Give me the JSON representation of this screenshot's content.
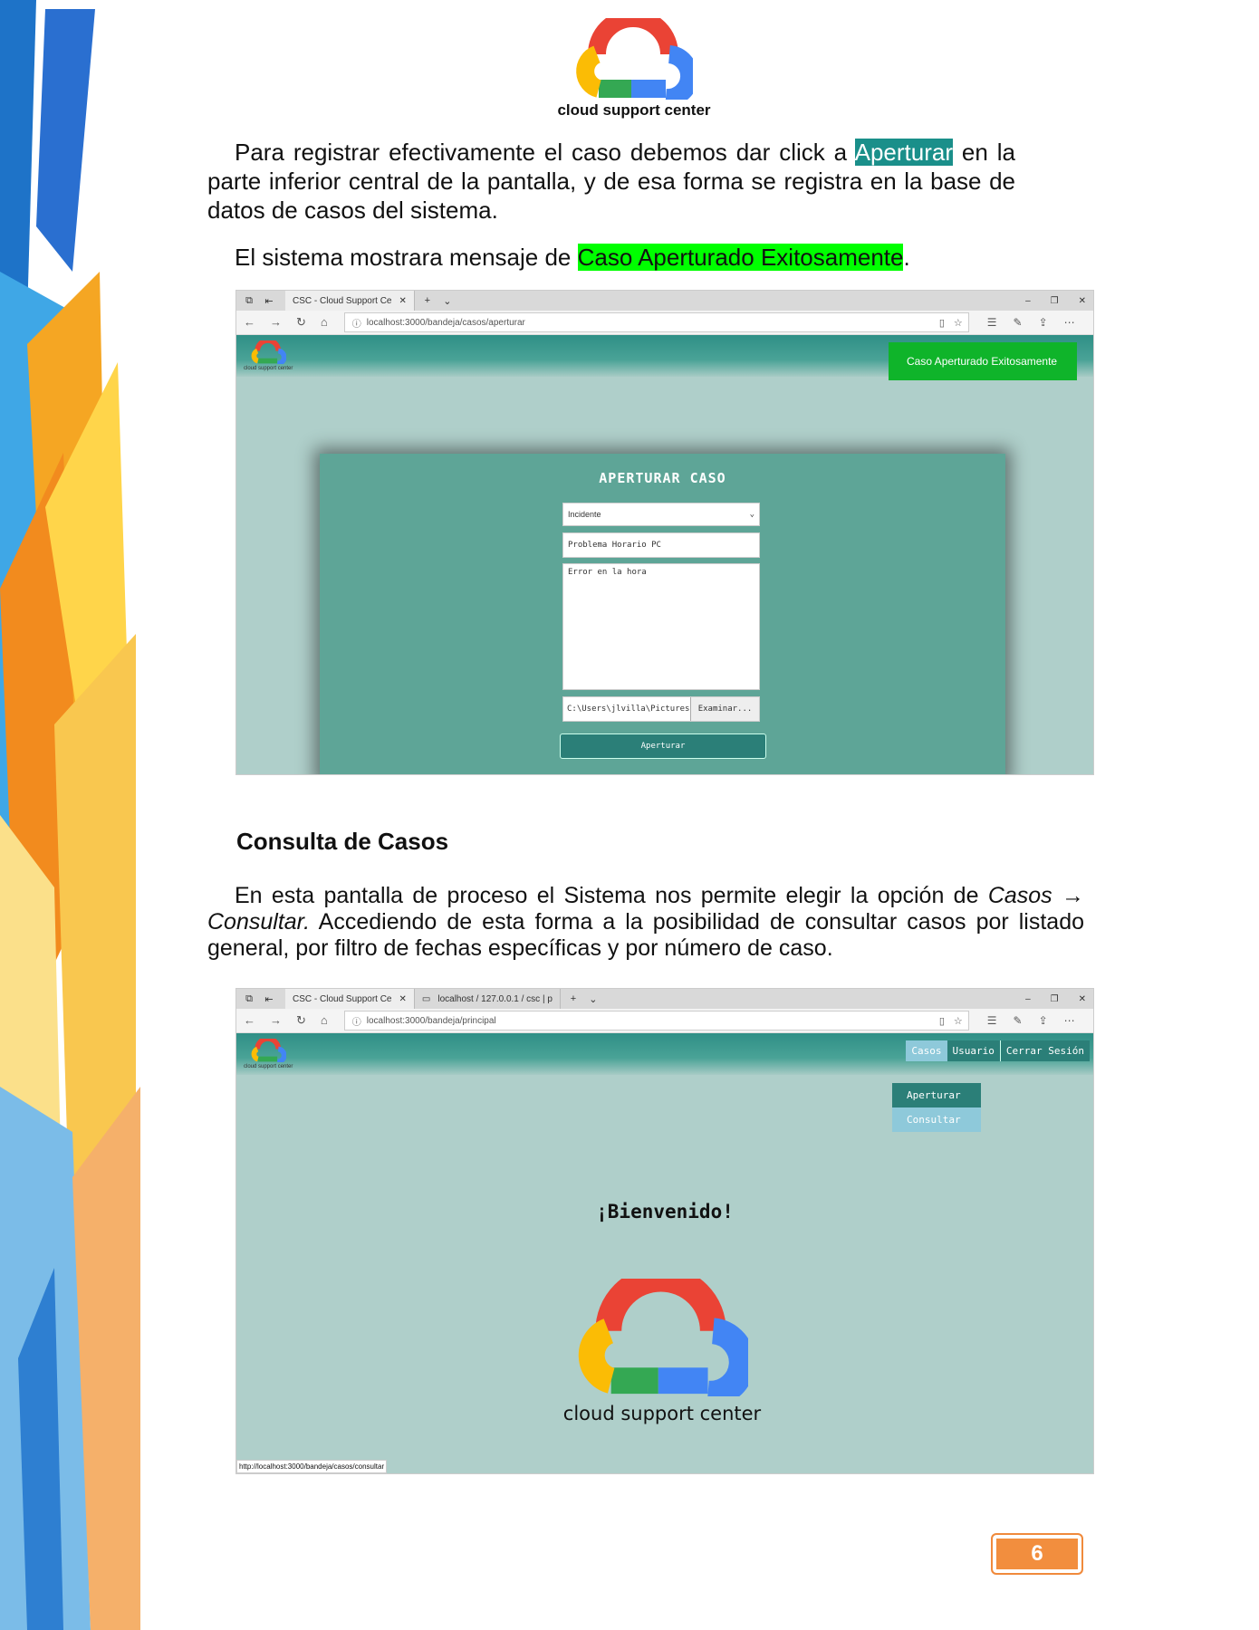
{
  "header": {
    "brand": "cloud support center"
  },
  "para1": {
    "before": "Para registrar efectivamente el caso debemos dar click a ",
    "highlight": "Aperturar",
    "after": " en la parte inferior central de la pantalla, y de esa forma se registra en la base de datos de casos del sistema."
  },
  "para2": {
    "before": "El sistema mostrara mensaje de ",
    "highlight": "Caso Aperturado Exitosamente",
    "after": "."
  },
  "shot1": {
    "tab_title": "CSC - Cloud Support Ce",
    "url": "localhost:3000/bandeja/casos/aperturar",
    "mini_brand": "cloud support center",
    "toast": "Caso Aperturado Exitosamente",
    "form": {
      "title": "APERTURAR CASO",
      "type_value": "Incidente",
      "subject_value": "Problema Horario PC",
      "description_value": "Error en la hora",
      "file_value": "C:\\Users\\jlvilla\\Pictures\\He",
      "browse_label": "Examinar...",
      "submit_label": "Aperturar"
    }
  },
  "section_title": "Consulta de Casos",
  "para3": {
    "before": "En esta pantalla de proceso el Sistema nos permite elegir la opción de ",
    "italic": "Casos → Consultar.",
    "after": " Accediendo de esta forma a la posibilidad de consultar casos por listado general, por filtro de fechas específicas y por número de caso."
  },
  "shot2": {
    "tab_title": "CSC - Cloud Support Ce",
    "tab2_title": "localhost / 127.0.0.1 / csc | p",
    "url": "localhost:3000/bandeja/principal",
    "mini_brand": "cloud support center",
    "menu": {
      "casos": "Casos",
      "usuario": "Usuario",
      "logout": "Cerrar Sesión"
    },
    "dropdown": {
      "aperturar": "Aperturar",
      "consultar": "Consultar"
    },
    "welcome": "¡Bienvenido!",
    "brand": "cloud support center",
    "status_url": "http://localhost:3000/bandeja/casos/consultar"
  },
  "page_number": "6",
  "colors": {
    "teal_highlight": "#1a8f8a",
    "green_highlight": "#00ff00",
    "toast": "#0fb42a",
    "page_badge": "#f28e3e"
  }
}
